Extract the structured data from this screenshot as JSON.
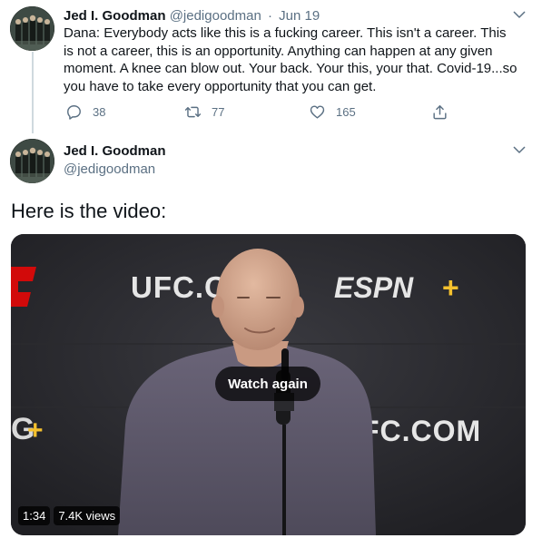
{
  "colors": {
    "text_primary": "#0f1419",
    "text_secondary": "#5b7083",
    "thread_line": "#cfd9de",
    "ufc_red": "#d20a0a",
    "espn_plus": "#f5c12e"
  },
  "reply_tweet": {
    "name": "Jed I. Goodman",
    "handle": "@jedigoodman",
    "separator": "·",
    "date": "Jun 19",
    "text": "Dana: Everybody acts like this is a fucking career. This isn't a career. This is not a career, this is an opportunity. Anything can happen at any given moment. A knee can blow out. Your back. Your this, your that. Covid-19...so you have to take every opportunity that you can get.",
    "actions": {
      "reply_count": "38",
      "retweet_count": "77",
      "like_count": "165"
    },
    "icons": [
      "reply-icon",
      "retweet-icon",
      "like-icon",
      "share-icon",
      "chevron-down-icon"
    ]
  },
  "main_tweet": {
    "name": "Jed I. Goodman",
    "handle": "@jedigoodman",
    "text": "Here is the video:",
    "video": {
      "watch_again_label": "Watch again",
      "duration": "1:34",
      "views": "7.4K views",
      "backdrop_text": {
        "ufc_left": "UFC.C",
        "espn": "ESPN",
        "espn_plus": "+",
        "ufc_right": "FC.COM"
      }
    }
  }
}
